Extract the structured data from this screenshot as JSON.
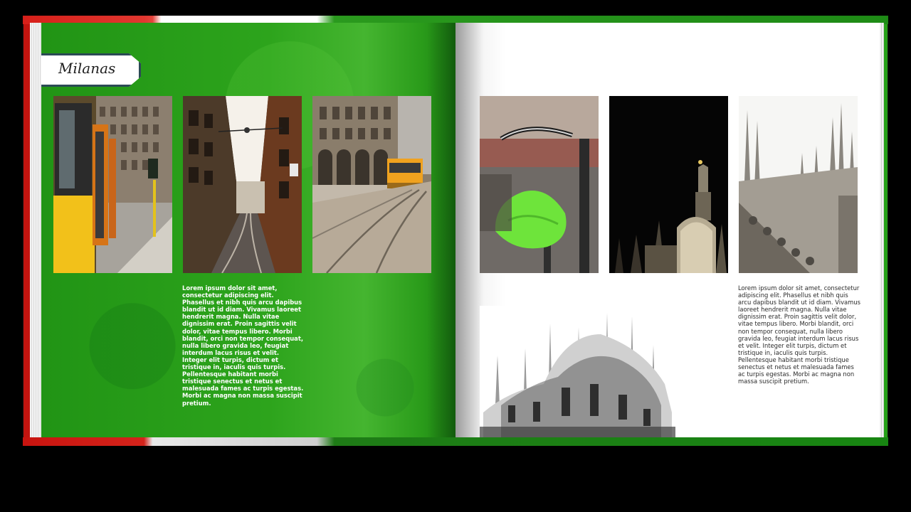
{
  "album": {
    "title": "Milanas"
  },
  "left_page": {
    "caption": "Lorem ipsum dolor sit amet, consectetur adipiscing elit. Phasellus et nibh quis arcu dapibus blandit ut id diam. Vivamus laoreet hendrerit magna. Nulla vitae dignissim erat. Proin sagittis velit dolor, vitae tempus libero. Morbi blandit, orci non tempor consequat, nulla libero gravida leo, feugiat interdum lacus risus et velit. Integer elit turpis, dictum et tristique in, iaculis quis turpis. Pellentesque habitant morbi tristique senectus et netus et malesuada fames ac turpis egestas. Morbi ac magna non massa suscipit pretium."
  },
  "right_page": {
    "caption": "Lorem ipsum dolor sit amet, consectetur adipiscing elit. Phasellus et nibh quis arcu dapibus blandit ut id diam. Vivamus laoreet hendrerit magna. Nulla vitae dignissim erat. Proin sagittis velit dolor, vitae tempus libero. Morbi blandit, orci non tempor consequat, nulla libero gravida leo, feugiat interdum lacus risus et velit. Integer elit turpis, dictum et tristique in, iaculis quis turpis. Pellentesque habitant morbi tristique senectus et netus et malesuada fames ac turpis egestas. Morbi ac magna non massa suscipit pretium."
  },
  "colors": {
    "page_green": "#2da41c",
    "flag_red": "#d21d17",
    "flag_white": "#ffffff",
    "label_border": "#2b4a55"
  }
}
